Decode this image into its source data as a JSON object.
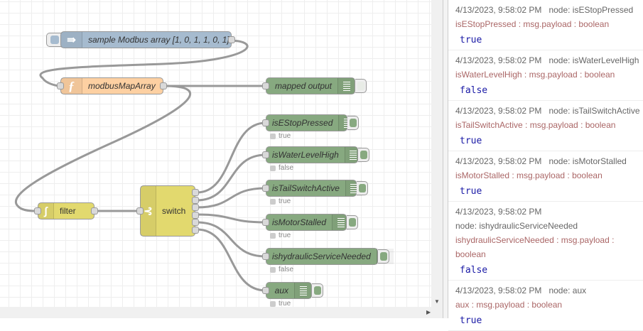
{
  "flow": {
    "nodes": {
      "inject": {
        "label": "sample Modbus array [1, 0, 1, 1, 0, 1]",
        "icon": "arrow-right-icon",
        "color": "#a6bbcf"
      },
      "function": {
        "label": "modbusMapArray",
        "icon": "function-icon",
        "color": "#fdd0a2"
      },
      "mapped": {
        "label": "mapped output"
      },
      "filter": {
        "label": "filter",
        "icon": "filter-icon",
        "color": "#e2d96e"
      },
      "switch": {
        "label": "switch",
        "icon": "switch-icon",
        "color": "#e2d96e"
      },
      "debug": [
        {
          "label": "isEStopPressed",
          "status": "true"
        },
        {
          "label": "isWaterLevelHigh",
          "status": "false"
        },
        {
          "label": "isTailSwitchActive",
          "status": "true"
        },
        {
          "label": "isMotorStalled",
          "status": "true"
        },
        {
          "label": "ishydraulicServiceNeeded",
          "status": "false"
        },
        {
          "label": "aux",
          "status": "true"
        }
      ],
      "debug_color": "#87a980"
    }
  },
  "sidebar": {
    "messages": [
      {
        "time": "4/13/2023, 9:58:02 PM",
        "node": "node: isEStopPressed",
        "topic": "isEStopPressed : msg.payload : boolean",
        "value": "true"
      },
      {
        "time": "4/13/2023, 9:58:02 PM",
        "node": "node: isWaterLevelHigh",
        "topic": "isWaterLevelHigh : msg.payload : boolean",
        "value": "false"
      },
      {
        "time": "4/13/2023, 9:58:02 PM",
        "node": "node: isTailSwitchActive",
        "topic": "isTailSwitchActive : msg.payload : boolean",
        "value": "true"
      },
      {
        "time": "4/13/2023, 9:58:02 PM",
        "node": "node: isMotorStalled",
        "topic": "isMotorStalled : msg.payload : boolean",
        "value": "true"
      },
      {
        "time": "4/13/2023, 9:58:02 PM",
        "node": "node: ishydraulicServiceNeeded",
        "topic": "ishydraulicServiceNeeded : msg.payload : boolean",
        "value": "false"
      },
      {
        "time": "4/13/2023, 9:58:02 PM",
        "node": "node: aux",
        "topic": "aux : msg.payload : boolean",
        "value": "true"
      }
    ]
  }
}
